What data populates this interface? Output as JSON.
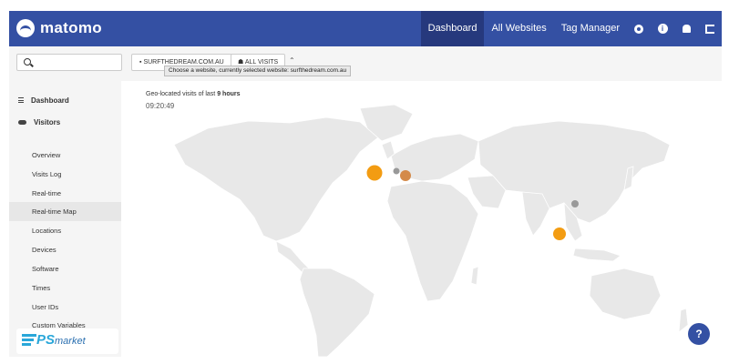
{
  "header": {
    "brand": "matomo",
    "nav": [
      {
        "label": "Dashboard",
        "active": true
      },
      {
        "label": "All Websites"
      },
      {
        "label": "Tag Manager"
      }
    ],
    "icons": [
      "gear-icon",
      "info-icon",
      "bell-icon",
      "logout-icon"
    ],
    "brand_color": "#3450a3"
  },
  "toolbar": {
    "site_label": "SURFTHEDREAM.COM.AU",
    "segment_label": "ALL VISITS",
    "tooltip": "Choose a website, currently selected website: surfthedream.com.au"
  },
  "sidebar": {
    "categories": [
      {
        "label": "Dashboard",
        "icon": "dashboard-icon"
      },
      {
        "label": "Visitors",
        "icon": "visitors-icon"
      }
    ],
    "items": [
      {
        "label": "Overview"
      },
      {
        "label": "Visits Log"
      },
      {
        "label": "Real-time"
      },
      {
        "label": "Real-time Map",
        "active": true
      },
      {
        "label": "Locations"
      },
      {
        "label": "Devices"
      },
      {
        "label": "Software"
      },
      {
        "label": "Times"
      },
      {
        "label": "User IDs"
      },
      {
        "label": "Custom Variables"
      }
    ]
  },
  "watermark": {
    "text": "PS",
    "sub": "market"
  },
  "map": {
    "title_prefix": "Geo-located visits of last ",
    "title_bold": "9 hours",
    "time": "09:20:49",
    "visit_colors": {
      "recent": "#f39c12",
      "older": "#d48a4a",
      "oldest": "#999999"
    }
  },
  "help": {
    "label": "?"
  }
}
